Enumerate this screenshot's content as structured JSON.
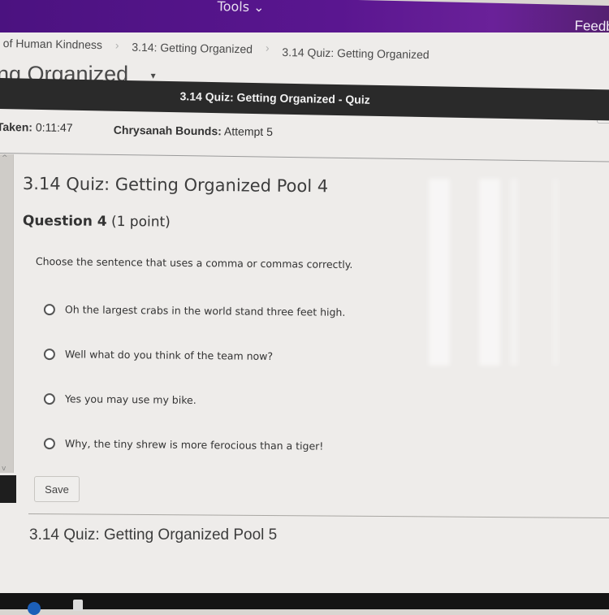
{
  "topbar": {
    "tools_label": "Tools ⌄",
    "feedback_label": "Feedba"
  },
  "breadcrumb": {
    "items": [
      {
        "label": "of Human Kindness"
      },
      {
        "label": "3.14: Getting Organized"
      },
      {
        "label": "3.14 Quiz: Getting Organized"
      }
    ],
    "separator": "›"
  },
  "page": {
    "title": "ng Organized",
    "title_caret": "▾"
  },
  "quiz_bar": {
    "title": "3.14 Quiz: Getting Organized - Quiz"
  },
  "info": {
    "time_label": "Taken:",
    "time_value": "0:11:47",
    "student_label": "Chrysanah Bounds:",
    "attempt_value": "Attempt 5"
  },
  "section": {
    "pool_title": "3.14 Quiz: Getting Organized Pool 4",
    "question_label": "Question 4",
    "question_points": "(1 point)",
    "prompt": "Choose the sentence that uses a comma or commas correctly.",
    "options": [
      {
        "label": "Oh the largest crabs in the world stand three feet high.",
        "selected": false
      },
      {
        "label": "Well what do you think of the team now?",
        "selected": false
      },
      {
        "label": "Yes you may use my bike.",
        "selected": false
      },
      {
        "label": "Why, the tiny shrew is more ferocious than a tiger!",
        "selected": false
      }
    ],
    "save_label": "Save"
  },
  "next_section": {
    "pool_title": "3.14 Quiz: Getting Organized Pool 5"
  },
  "scrollbar": {
    "up_icon": "^",
    "down_icon": "v"
  },
  "colors": {
    "header_purple": "#5a1690",
    "quiz_bar": "#2a2a2a"
  }
}
